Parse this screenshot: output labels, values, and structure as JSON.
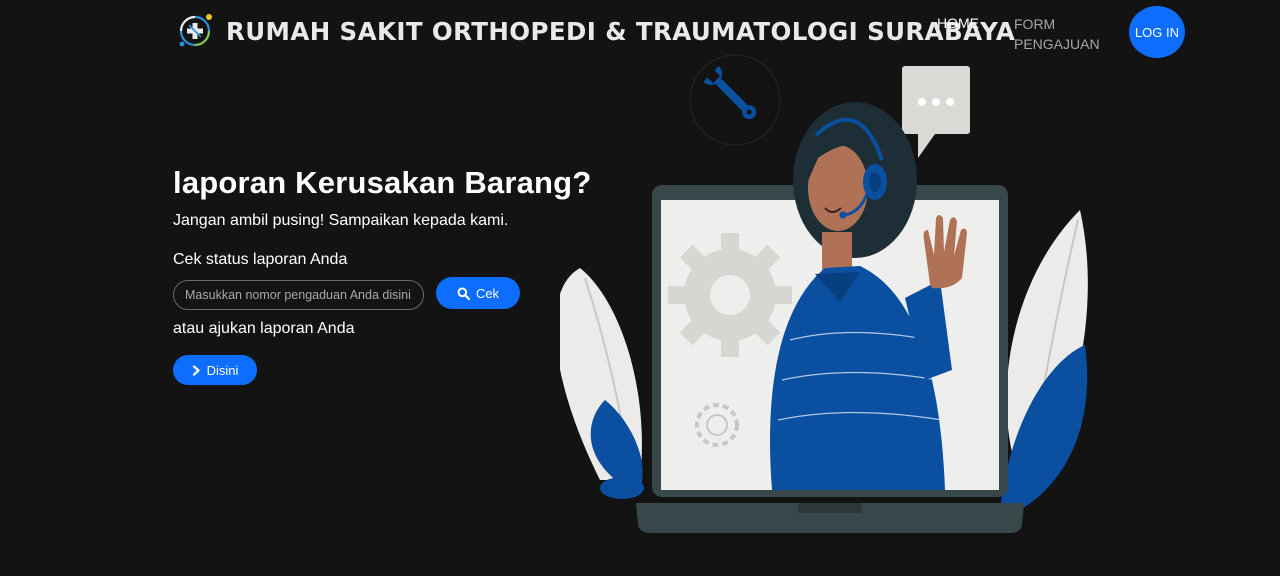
{
  "header": {
    "brand_title": "RUMAH SAKIT ORTHOPEDI & TRAUMATOLOGI SURABAYA",
    "logo_icon": "hospital-logo-icon",
    "nav": {
      "home": "HOME",
      "form": "FORM PENGAJUAN",
      "login": "LOG IN"
    }
  },
  "hero": {
    "title": "laporan Kerusakan Barang?",
    "subtitle": "Jangan ambil pusing! Sampaikan kepada kami.",
    "status_label": "Cek status laporan Anda",
    "search_placeholder": "Masukkan nomor pengaduan Anda disini",
    "cek_label": "Cek",
    "ajukan_label": "atau ajukan laporan Anda",
    "disini_label": "Disini"
  },
  "icons": {
    "search": "search-icon",
    "chevron": "chevron-right-icon"
  },
  "colors": {
    "background": "#131314",
    "primary": "#0d6efd",
    "text": "#ffffff",
    "nav_muted": "#a5a6a8",
    "illustration_blue": "#0b4fa0",
    "laptop_frame": "#37474a"
  }
}
